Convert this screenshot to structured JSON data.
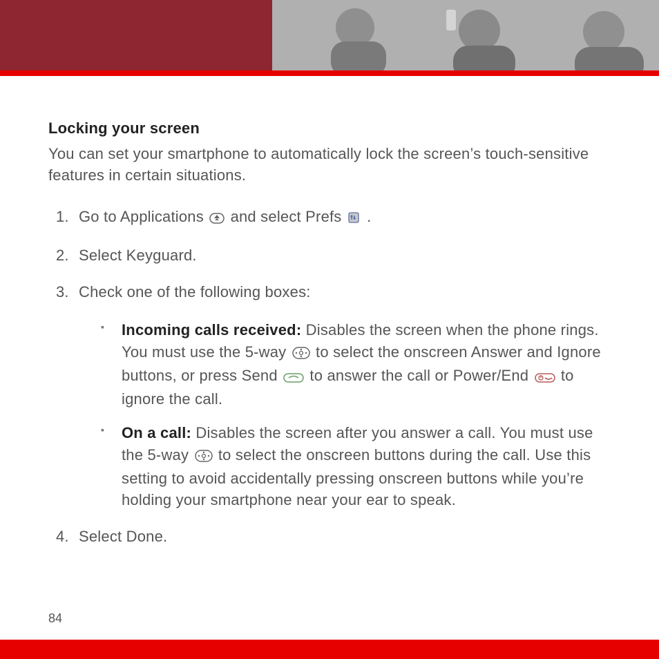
{
  "title": "Locking your screen",
  "intro": "You can set your smartphone to automatically lock the screen’s touch-sensitive features in certain situations.",
  "steps": {
    "s1a": "Go to Applications ",
    "s1b": " and select Prefs ",
    "s1c": " .",
    "s2": "Select Keyguard.",
    "s3": "Check one of the following boxes:",
    "s4": "Select Done."
  },
  "bullets": {
    "b1_title": "Incoming calls received: ",
    "b1a": "Disables the screen when the phone rings. You must use the 5-way ",
    "b1b": " to select the onscreen Answer and Ignore buttons, or press Send ",
    "b1c": " to answer the call or Power/End ",
    "b1d": " to ignore the call.",
    "b2_title": "On a call: ",
    "b2a": "Disables the screen after you answer a call. You must use the 5-way ",
    "b2b": " to select the onscreen buttons during the call. Use this setting to avoid accidentally pressing onscreen buttons while you’re holding your smartphone near your ear to speak."
  },
  "page_number": "84"
}
